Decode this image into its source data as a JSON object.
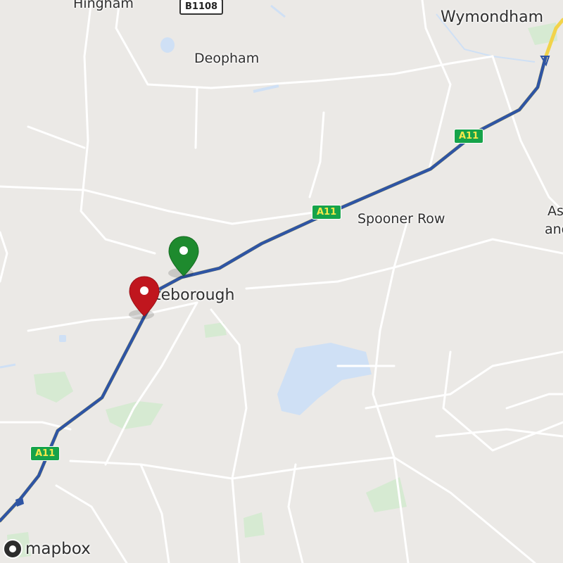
{
  "map": {
    "places": [
      {
        "name": "Hingham",
        "type": "village"
      },
      {
        "name": "Deopham",
        "type": "village"
      },
      {
        "name": "Wymondham",
        "type": "town"
      },
      {
        "name": "Spooner Row",
        "type": "village"
      },
      {
        "name": "Attleborough",
        "visible_text": "teborough",
        "type": "town"
      },
      {
        "name": "As and",
        "visible_text": "As",
        "visible_text_2": "and",
        "type": "town"
      }
    ],
    "road_shields": [
      {
        "label": "B1108",
        "style": "white"
      },
      {
        "label": "A11",
        "style": "green"
      },
      {
        "label": "A11",
        "style": "green"
      },
      {
        "label": "A11",
        "style": "green"
      }
    ],
    "markers": [
      {
        "name": "start",
        "color": "#1e8a2e",
        "icon": "map-pin-icon"
      },
      {
        "name": "end",
        "color": "#c0161e",
        "icon": "map-pin-icon"
      }
    ],
    "route": {
      "color": "#2f55a4",
      "road": "A11"
    },
    "attribution": {
      "logo_text": "mapbox"
    },
    "colors": {
      "land": "#ebe9e6",
      "road": "#ffffff",
      "motorway": "#f2d34a",
      "water": "#cfe0f5",
      "park": "#d6ead2"
    }
  }
}
